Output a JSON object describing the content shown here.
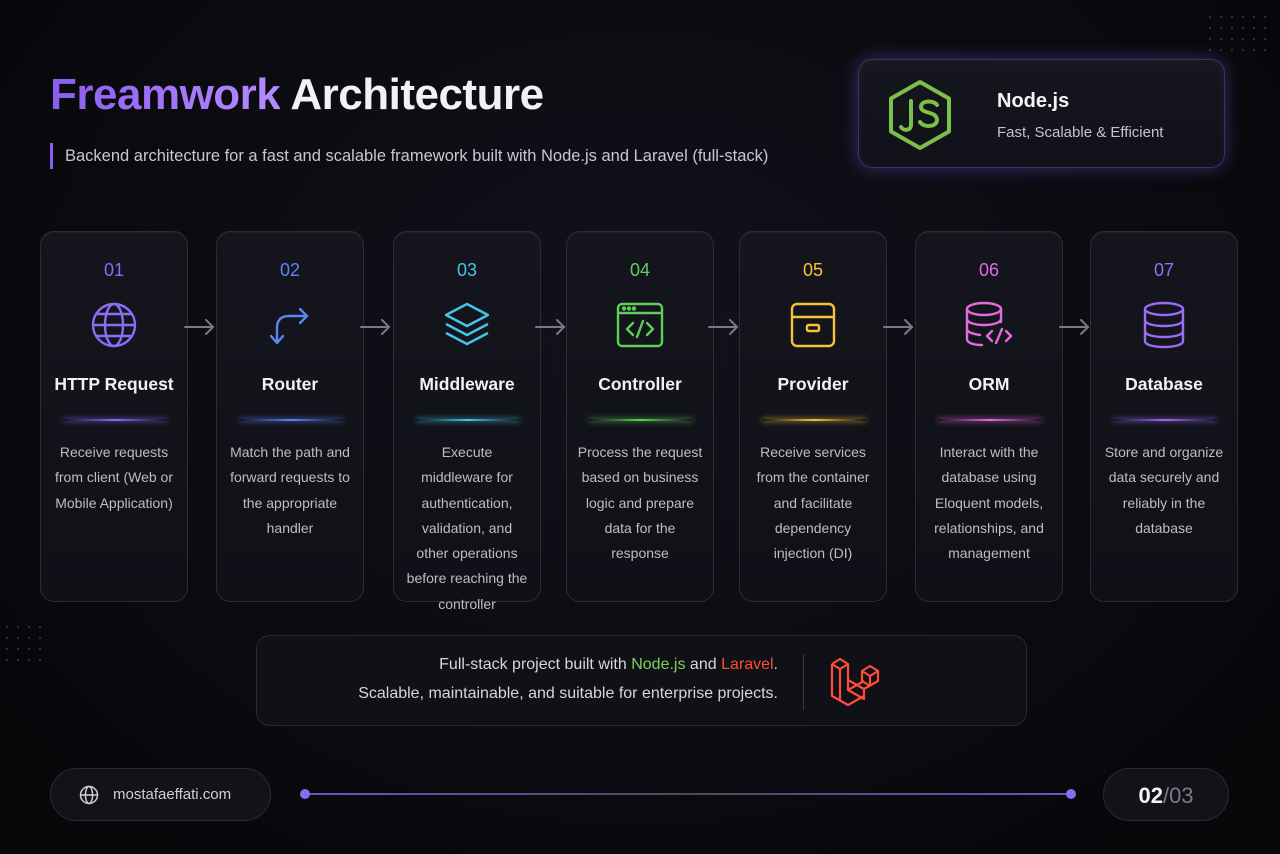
{
  "header": {
    "title_accent": "Freamwork",
    "title_rest": "Architecture",
    "subtitle": "Backend architecture for a fast and scalable framework built with Node.js and Laravel (full-stack)"
  },
  "node_card": {
    "title": "Node.js",
    "subtitle": "Fast, Scalable & Efficient",
    "icon": "nodejs-logo"
  },
  "steps": [
    {
      "num": "01",
      "name": "HTTP Request",
      "icon": "globe-icon",
      "color": "#8b6cf4",
      "desc": "Receive requests from client (Web or Mobile Application)"
    },
    {
      "num": "02",
      "name": "Router",
      "icon": "route-arrow-icon",
      "color": "#5a86f5",
      "desc": "Match the path and forward requests to the appropriate handler"
    },
    {
      "num": "03",
      "name": "Middleware",
      "icon": "layers-icon",
      "color": "#43c6e6",
      "desc": "Execute middleware for authentication, validation, and other operations before reaching the controller"
    },
    {
      "num": "04",
      "name": "Controller",
      "icon": "code-window-icon",
      "color": "#5fcf5a",
      "desc": "Process the request based on business logic and prepare data for the response"
    },
    {
      "num": "05",
      "name": "Provider",
      "icon": "box-icon",
      "color": "#f3c43a",
      "desc": "Receive services from the container and facilitate dependency injection (DI)"
    },
    {
      "num": "06",
      "name": "ORM",
      "icon": "database-code-icon",
      "color": "#e46ae0",
      "desc": "Interact with the database using Eloquent models, relationships, and management"
    },
    {
      "num": "07",
      "name": "Database",
      "icon": "database-icon",
      "color": "#9b6cf4",
      "desc": "Store and organize data securely and reliably in the database"
    }
  ],
  "footer": {
    "line1_pre": "Full-stack project built with ",
    "line1_node": "Node.js",
    "line1_and": " and ",
    "line1_laravel": "Laravel",
    "line1_end": ".",
    "line2": "Scalable, maintainable, and suitable for enterprise projects.",
    "icon": "laravel-logo"
  },
  "bottom": {
    "website": "mostafaeffati.com",
    "page_current": "02",
    "page_sep": "/",
    "page_total": "03"
  }
}
